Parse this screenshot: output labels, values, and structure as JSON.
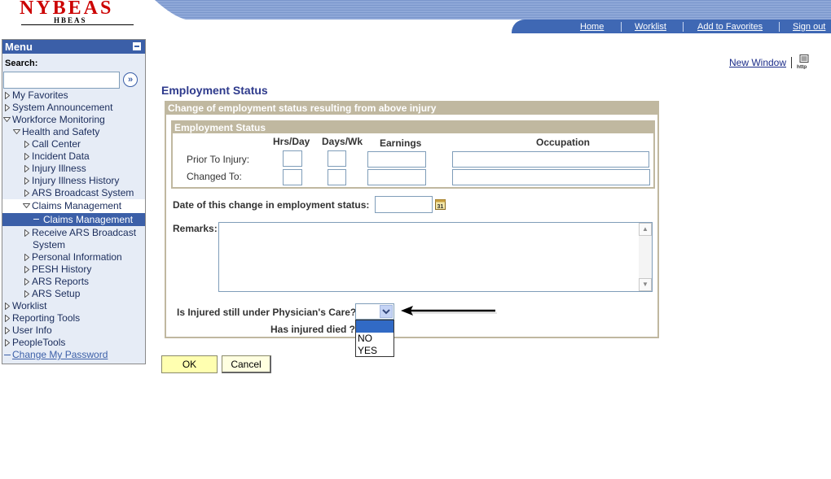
{
  "header": {
    "logo_main": "NYBEAS",
    "logo_sub": "HBEAS",
    "nav": [
      {
        "label": "Home"
      },
      {
        "label": "Worklist"
      },
      {
        "label": "Add to Favorites"
      },
      {
        "label": "Sign out"
      }
    ]
  },
  "sidebar": {
    "title": "Menu",
    "search_label": "Search:",
    "search_value": "",
    "items": [
      {
        "label": "My Favorites"
      },
      {
        "label": "System Announcement"
      },
      {
        "label": "Workforce Monitoring"
      },
      {
        "label": "Health and Safety"
      },
      {
        "label": "Call Center"
      },
      {
        "label": "Incident Data"
      },
      {
        "label": "Injury Illness"
      },
      {
        "label": "Injury Illness History"
      },
      {
        "label": "ARS Broadcast System"
      },
      {
        "label": "Claims Management"
      },
      {
        "label": "Claims Management"
      },
      {
        "label": "Receive ARS Broadcast"
      },
      {
        "label": "System"
      },
      {
        "label": "Personal Information"
      },
      {
        "label": "PESH History"
      },
      {
        "label": "ARS Reports"
      },
      {
        "label": "ARS Setup"
      },
      {
        "label": "Worklist"
      },
      {
        "label": "Reporting Tools"
      },
      {
        "label": "User Info"
      },
      {
        "label": "PeopleTools"
      },
      {
        "label": "Change My Password"
      }
    ]
  },
  "page": {
    "new_window": "New Window",
    "http_icon_text": "http",
    "title": "Employment Status",
    "section_title": "Change of employment status resulting from above injury",
    "subsection_title": "Employment Status",
    "columns": {
      "hrs_day": "Hrs/Day",
      "days_wk": "Days/Wk",
      "earnings": "Earnings",
      "occupation": "Occupation"
    },
    "rows": {
      "prior": "Prior To Injury:",
      "changed": "Changed To:"
    },
    "date_label": "Date of this change in employment status:",
    "remarks_label": "Remarks:",
    "physician_label": "Is Injured still under Physician's Care?",
    "died_label": "Has injured died ?",
    "dropdown_options": [
      "",
      "NO",
      "YES"
    ],
    "ok_label": "OK",
    "cancel_label": "Cancel"
  },
  "colors": {
    "menu_blue": "#3b5fa8",
    "box_tan": "#c0b8a0",
    "title_blue": "#2e3a8c"
  }
}
